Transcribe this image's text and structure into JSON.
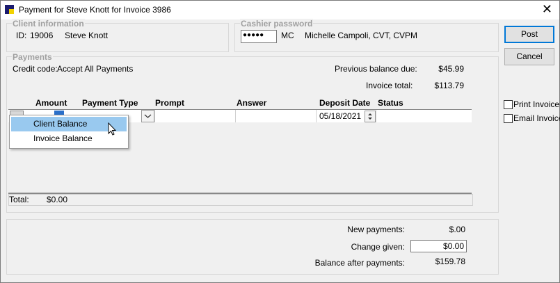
{
  "window": {
    "title": "Payment for Steve Knott for Invoice 3986"
  },
  "client_info": {
    "legend": "Client information",
    "id_label": "ID:",
    "id": "19006",
    "name": "Steve Knott"
  },
  "cashier": {
    "legend": "Cashier password",
    "password_mask": "●●●●●",
    "initials": "MC",
    "name": "Michelle Campoli, CVT, CVPM"
  },
  "buttons": {
    "post": "Post",
    "cancel": "Cancel"
  },
  "payments": {
    "legend": "Payments",
    "credit_code_label": "Credit code:",
    "credit_code_value": "Accept All Payments",
    "previous_balance_label": "Previous balance due:",
    "previous_balance": "$45.99",
    "invoice_total_label": "Invoice total:",
    "invoice_total": "$113.79",
    "columns": [
      "Amount",
      "Payment Type",
      "Prompt",
      "Answer",
      "Deposit Date",
      "Status"
    ],
    "row": {
      "deposit_date": "05/18/2021"
    },
    "dropdown_options": [
      "Client Balance",
      "Invoice Balance"
    ],
    "total_label": "Total:",
    "total_value": "$0.00"
  },
  "options": {
    "print_invoice": "Print Invoice",
    "email_invoice": "Email Invoice"
  },
  "summary": {
    "new_payments_label": "New payments:",
    "new_payments": "$.00",
    "change_given_label": "Change given:",
    "change_given": "$0.00",
    "balance_after_label": "Balance after payments:",
    "balance_after": "$159.78"
  }
}
